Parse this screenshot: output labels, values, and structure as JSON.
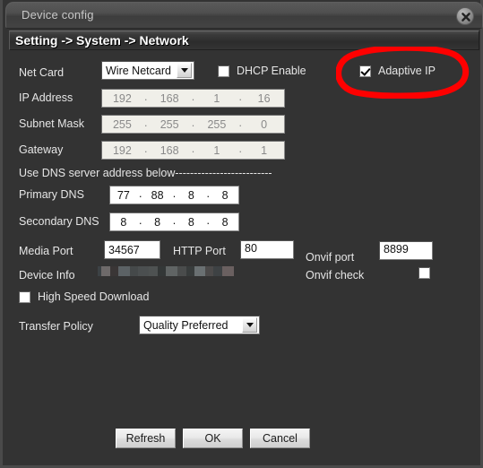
{
  "window": {
    "title": "Device config",
    "close_icon": "close-icon"
  },
  "section": {
    "breadcrumb": "Setting -> System -> Network"
  },
  "form": {
    "net_card": {
      "label": "Net Card",
      "value": "Wire Netcard",
      "options": [
        "Wire Netcard"
      ]
    },
    "dhcp_enable": {
      "label": "DHCP Enable",
      "checked": false
    },
    "adaptive_ip": {
      "label": "Adaptive IP",
      "checked": true
    },
    "ip_address": {
      "label": "IP Address",
      "octets": [
        "192",
        "168",
        "1",
        "16"
      ],
      "disabled": true
    },
    "subnet_mask": {
      "label": "Subnet Mask",
      "octets": [
        "255",
        "255",
        "255",
        "0"
      ],
      "disabled": true
    },
    "gateway": {
      "label": "Gateway",
      "octets": [
        "192",
        "168",
        "1",
        "1"
      ],
      "disabled": true
    },
    "dns_note": "Use DNS server address below--------------------------",
    "primary_dns": {
      "label": "Primary DNS",
      "octets": [
        "77",
        "88",
        "8",
        "8"
      ]
    },
    "secondary_dns": {
      "label": "Secondary DNS",
      "octets": [
        "8",
        "8",
        "8",
        "8"
      ]
    },
    "media_port": {
      "label": "Media Port",
      "value": "34567"
    },
    "http_port": {
      "label": "HTTP Port",
      "value": "80"
    },
    "onvif_port": {
      "label": "Onvif port",
      "value": "8899"
    },
    "device_info": {
      "label": "Device Info",
      "value": ""
    },
    "onvif_check": {
      "label": "Onvif check",
      "checked": false
    },
    "high_speed_download": {
      "label": "High Speed Download",
      "checked": false
    },
    "transfer_policy": {
      "label": "Transfer Policy",
      "value": "Quality Preferred",
      "options": [
        "Quality Preferred"
      ]
    }
  },
  "buttons": {
    "refresh": "Refresh",
    "ok": "OK",
    "cancel": "Cancel"
  },
  "annotation": {
    "type": "hand-drawn-ellipse",
    "color": "#fe0000",
    "target": "Adaptive IP"
  },
  "colors": {
    "window_bg": "#333333",
    "titlebar": "#4f4f4f",
    "label_text": "#e6e6e6",
    "input_bg": "#ffffff",
    "disabled_input_bg": "#f0efe9",
    "disabled_text": "#8a8a8a",
    "annotation_red": "#fe0000"
  }
}
